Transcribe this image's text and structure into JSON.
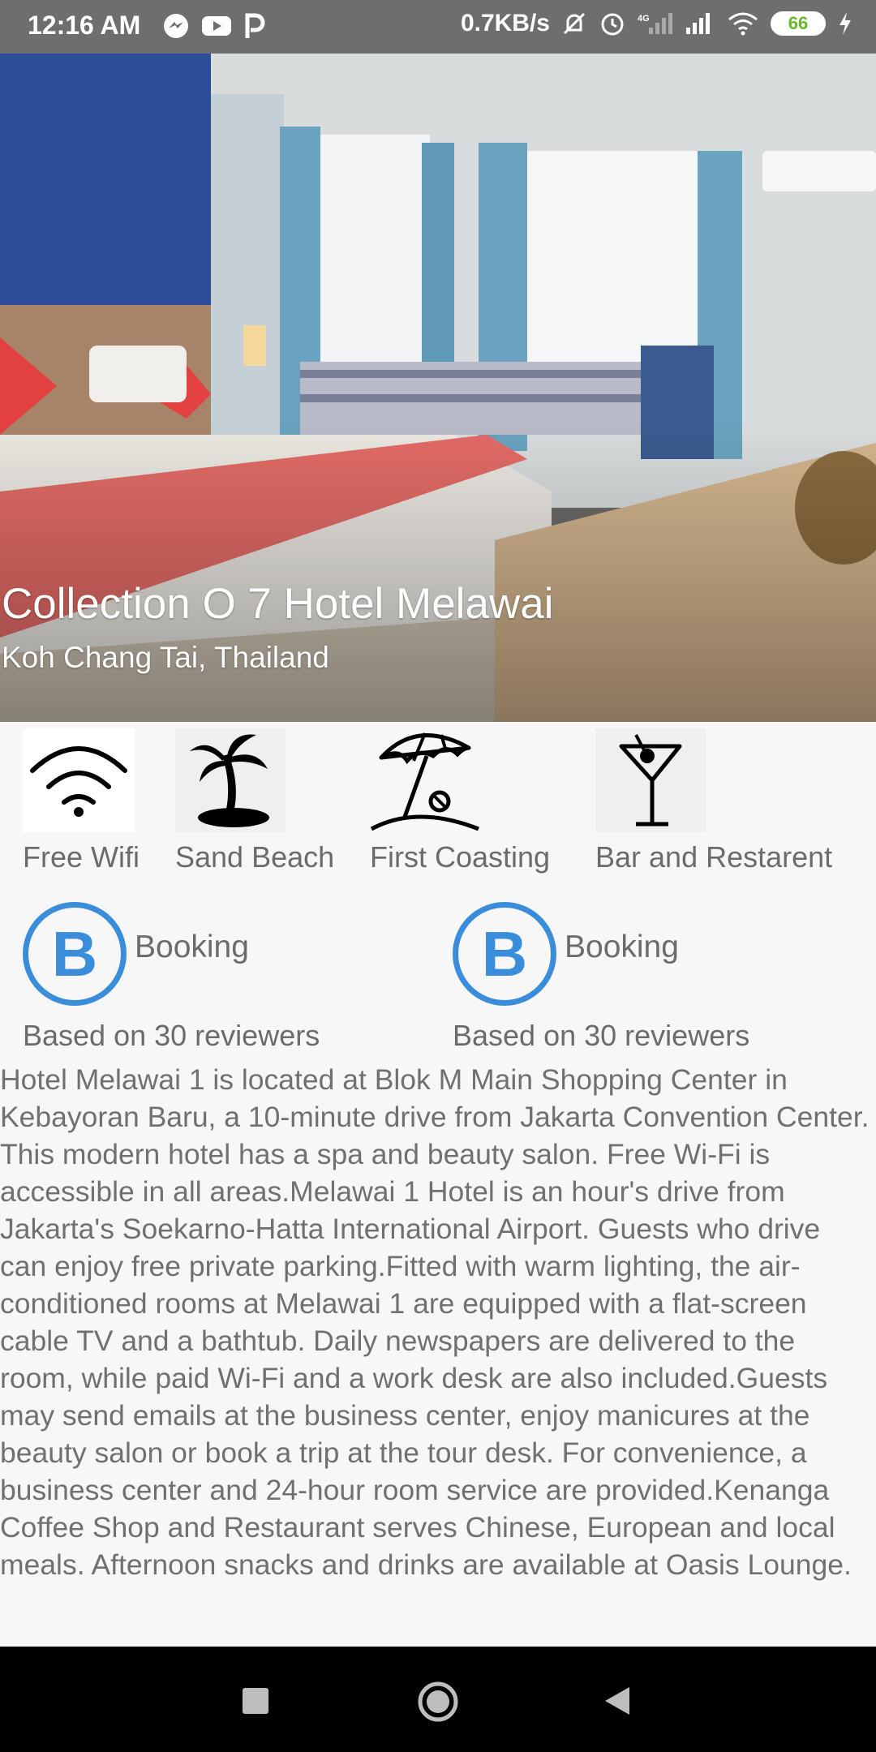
{
  "status_bar": {
    "time": "12:16 AM",
    "net_speed": "0.7KB/s",
    "battery": "66",
    "network_label": "4G"
  },
  "hero": {
    "title": "Collection O 7 Hotel Melawai",
    "subtitle": "Koh Chang Tai, Thailand"
  },
  "amenities": [
    {
      "label": "Free Wifi",
      "icon": "wifi-icon"
    },
    {
      "label": "Sand Beach",
      "icon": "palm-tree-icon"
    },
    {
      "label": "First Coasting",
      "icon": "beach-umbrella-icon"
    },
    {
      "label": "Bar and Restarent",
      "icon": "cocktail-icon"
    }
  ],
  "ratings": [
    {
      "letter": "B",
      "label": "Booking",
      "reviews": "Based on 30 reviewers"
    },
    {
      "letter": "B",
      "label": "Booking",
      "reviews": "Based on 30 reviewers"
    }
  ],
  "description": "Hotel Melawai 1 is located at Blok M Main Shopping Center in Kebayoran Baru, a 10-minute drive from Jakarta Convention Center. This modern hotel has a spa and beauty salon. Free Wi-Fi is accessible in all areas.Melawai 1 Hotel is an hour's drive from Jakarta's Soekarno-Hatta International Airport. Guests who drive can enjoy free private parking.Fitted with warm lighting, the air-conditioned rooms at Melawai 1 are equipped with a flat-screen cable TV and a bathtub. Daily newspapers are delivered to the room, while paid Wi-Fi and a work desk are also included.Guests may send emails at the business center, enjoy manicures at the beauty salon or book a trip at the tour desk. For convenience, a business center and 24-hour room service are provided.Kenanga Coffee Shop and Restaurant serves Chinese, European and local meals. Afternoon snacks and drinks are available at Oasis Lounge.",
  "colors": {
    "accent": "#3a8ddb",
    "text": "#6b6b6b",
    "status_bar": "#6e6e6e"
  }
}
